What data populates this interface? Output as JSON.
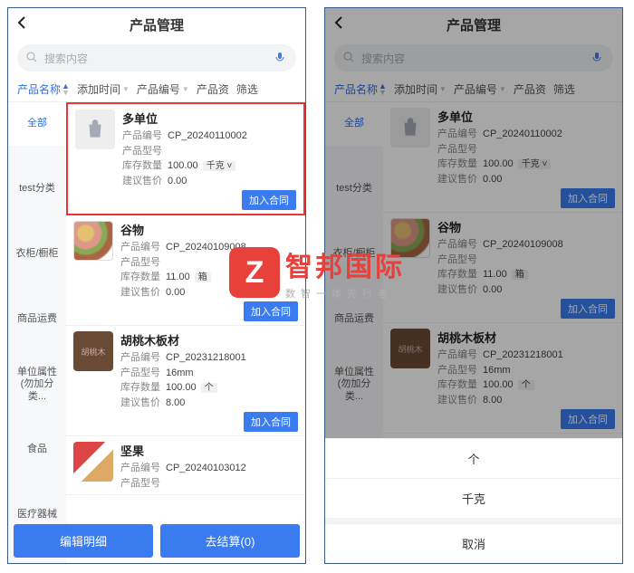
{
  "header": {
    "title": "产品管理"
  },
  "search": {
    "placeholder": "搜索内容"
  },
  "filters": {
    "name": "产品名称",
    "time": "添加时间",
    "code": "产品编号",
    "asset": "产品资",
    "filter": "筛选"
  },
  "categories": [
    "全部",
    "",
    "test分类",
    "",
    "衣柜/橱柜",
    "",
    "商品运费",
    "",
    "单位属性(勿加分类...",
    "",
    "食品",
    "",
    "医疗器械"
  ],
  "labels": {
    "code": "产品编号",
    "model": "产品型号",
    "stock": "库存数量",
    "price": "建议售价",
    "add": "加入合同"
  },
  "products": [
    {
      "name": "多单位",
      "code": "CP_20240110002",
      "model": "",
      "stock": "100.00",
      "unit": "千克",
      "price": "0.00",
      "thumb": "bag"
    },
    {
      "name": "谷物",
      "code": "CP_20240109008",
      "model": "",
      "stock": "11.00",
      "unit": "箱",
      "price": "0.00",
      "thumb": "grains"
    },
    {
      "name": "胡桃木板材",
      "code": "CP_20231218001",
      "model": "16mm",
      "stock": "100.00",
      "unit": "个",
      "price": "8.00",
      "thumb": "walnut"
    },
    {
      "name": "坚果",
      "code": "CP_20240103012",
      "model": "",
      "stock": "",
      "unit": "",
      "price": "",
      "thumb": "nuts"
    }
  ],
  "buttons": {
    "edit": "编辑明细",
    "checkout": "去结算(0)"
  },
  "sheet": {
    "opt1": "个",
    "opt2": "千克",
    "cancel": "取消"
  },
  "wm": {
    "logo": "Z",
    "big": "智邦国际",
    "small": "数智一体先行者"
  }
}
